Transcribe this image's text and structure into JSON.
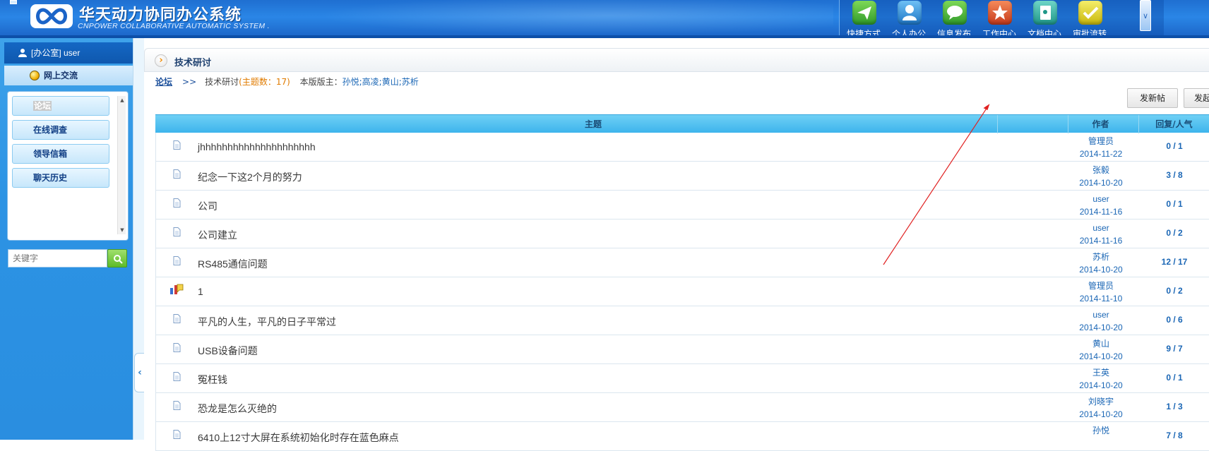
{
  "header": {
    "title": "华天动力协同办公系统",
    "subtitle": "CNPOWER COLLABORATIVE AUTOMATIC SYSTEM .",
    "nav": [
      {
        "label": "快捷方式",
        "icon": "paper-plane-icon",
        "color": "#3aa935"
      },
      {
        "label": "个人办公",
        "icon": "person-icon",
        "color": "#2a83c9"
      },
      {
        "label": "信息发布",
        "icon": "speech-bubble-icon",
        "color": "#3aa935"
      },
      {
        "label": "工作中心",
        "icon": "star-icon",
        "color": "#d9532b"
      },
      {
        "label": "文档中心",
        "icon": "document-icon",
        "color": "#33a897"
      },
      {
        "label": "审批流转",
        "icon": "checkmark-icon",
        "color": "#d6cc14"
      }
    ]
  },
  "sidebar": {
    "user": "[办公室] user",
    "section": "网上交流",
    "items": [
      {
        "label": "论坛",
        "active": true
      },
      {
        "label": "在线调查"
      },
      {
        "label": "领导信箱"
      },
      {
        "label": "聊天历史"
      }
    ],
    "search": {
      "placeholder": "关键字"
    }
  },
  "main": {
    "page_title": "技术研讨",
    "breadcrumb": {
      "root": "论坛",
      "sep": ">>",
      "current": "技术研讨",
      "count_text": "(主题数：17)",
      "moderators_label": "本版版主：",
      "moderators": "孙悦;高凌;黄山;苏析"
    },
    "buttons": {
      "new_post": "发新帖",
      "new_poll": "发起投票"
    },
    "table": {
      "headers": {
        "subject": "主题",
        "author": "作者",
        "replies": "回复/人气"
      },
      "rows": [
        {
          "subject": "jhhhhhhhhhhhhhhhhhhhhh",
          "author": "管理员",
          "date": "2014-11-22",
          "replies": "0 / 1",
          "icon": "doc"
        },
        {
          "subject": "纪念一下这2个月的努力",
          "author": "张毅",
          "date": "2014-10-20",
          "replies": "3 / 8",
          "icon": "doc"
        },
        {
          "subject": "公司",
          "author": "user",
          "date": "2014-11-16",
          "replies": "0 / 1",
          "icon": "doc"
        },
        {
          "subject": "公司建立",
          "author": "user",
          "date": "2014-11-16",
          "replies": "0 / 2",
          "icon": "doc"
        },
        {
          "subject": "RS485通信问题",
          "author": "苏析",
          "date": "2014-10-20",
          "replies": "12 / 17",
          "icon": "doc"
        },
        {
          "subject": "1",
          "author": "管理员",
          "date": "2014-11-10",
          "replies": "0 / 2",
          "icon": "poll"
        },
        {
          "subject": "平凡的人生，平凡的日子平常过",
          "author": "user",
          "date": "2014-10-20",
          "replies": "0 / 6",
          "icon": "doc"
        },
        {
          "subject": "USB设备问题",
          "author": "黄山",
          "date": "2014-10-20",
          "replies": "9 / 7",
          "icon": "doc"
        },
        {
          "subject": "冤枉钱",
          "author": "王英",
          "date": "2014-10-20",
          "replies": "0 / 1",
          "icon": "doc"
        },
        {
          "subject": "恐龙是怎么灭绝的",
          "author": "刘晓宇",
          "date": "2014-10-20",
          "replies": "1 / 3",
          "icon": "doc"
        },
        {
          "subject": "6410上12寸大屏在系统初始化时存在蓝色麻点",
          "author": "孙悦",
          "date": "",
          "replies": "7 / 8",
          "icon": "doc"
        }
      ]
    }
  }
}
